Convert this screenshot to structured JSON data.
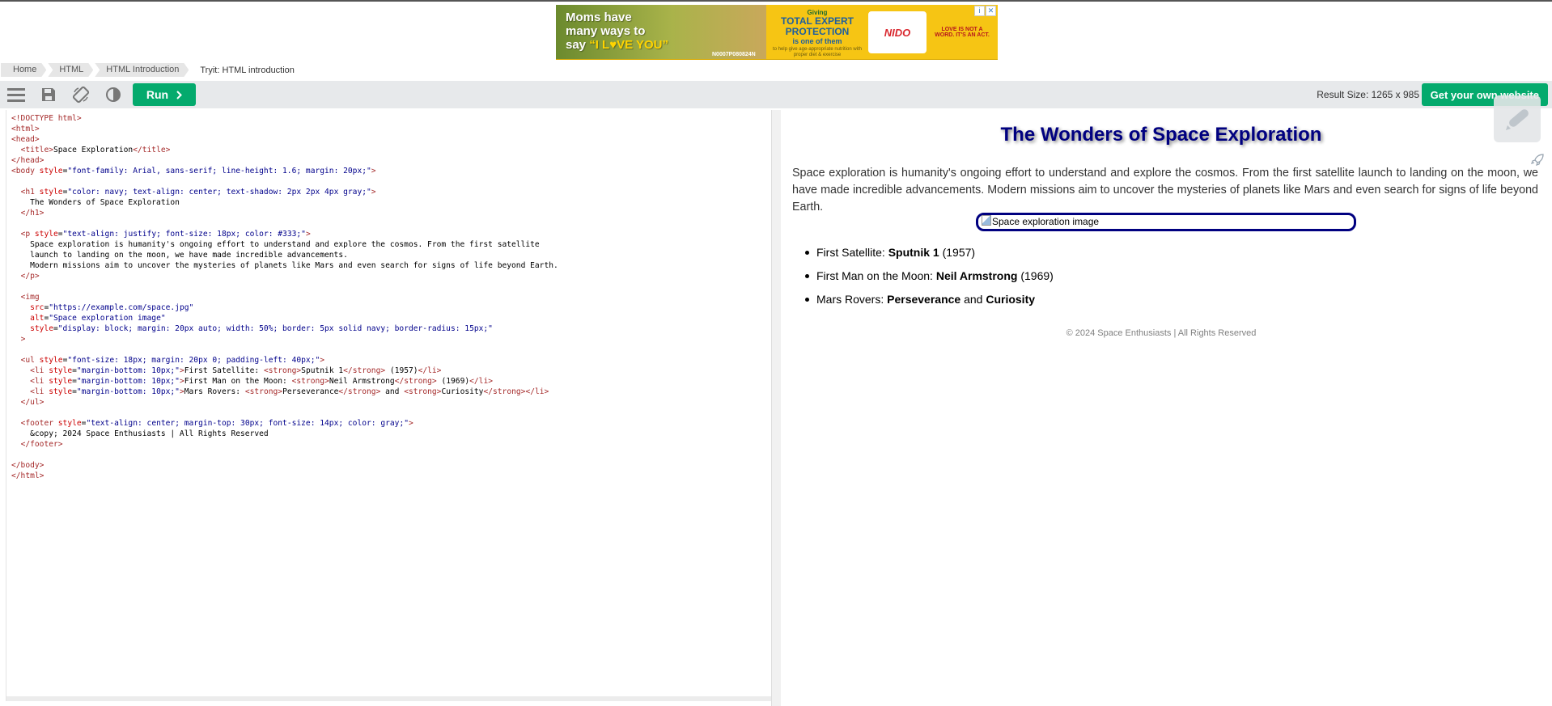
{
  "ad": {
    "left_line1": "Moms have",
    "left_line2": "many ways to",
    "left_line3_prefix": "say ",
    "left_line3_highlight": "“I L♥VE YOU”",
    "code": "N0007P080824N",
    "giving": "Giving",
    "headline1": "TOTAL EXPERT",
    "headline2": "PROTECTION",
    "sub": "is one of them",
    "small": "to help give age-appropriate nutrition with proper diet & exercise",
    "brand": "NIDO",
    "right_text": "LOVE IS NOT A WORD. IT'S AN ACT.",
    "info_icon": "i",
    "close_icon": "✕"
  },
  "breadcrumb": {
    "items": [
      "Home",
      "HTML",
      "HTML Introduction"
    ],
    "current": "Tryit: HTML introduction"
  },
  "toolbar": {
    "run_label": "Run",
    "result_size": "Result Size: 1265 x 985",
    "own_site_label": "Get your own website"
  },
  "result": {
    "title": "The Wonders of Space Exploration",
    "paragraph": "Space exploration is humanity's ongoing effort to understand and explore the cosmos. From the first satellite launch to landing on the moon, we have made incredible advancements. Modern missions aim to uncover the mysteries of planets like Mars and even search for signs of life beyond Earth.",
    "image_alt": "Space exploration image",
    "list": [
      {
        "prefix": "First Satellite: ",
        "strong": "Sputnik 1",
        "suffix": " (1957)"
      },
      {
        "prefix": "First Man on the Moon: ",
        "strong": "Neil Armstrong",
        "suffix": " (1969)"
      },
      {
        "prefix": "Mars Rovers: ",
        "strong": "Perseverance",
        "mid": " and ",
        "strong2": "Curiosity",
        "suffix": ""
      }
    ],
    "footer": "© 2024 Space Enthusiasts | All Rights Reserved"
  },
  "colors": {
    "accent": "#04aa6d",
    "toolbar_bg": "#e7e9eb",
    "title": "#000080"
  }
}
